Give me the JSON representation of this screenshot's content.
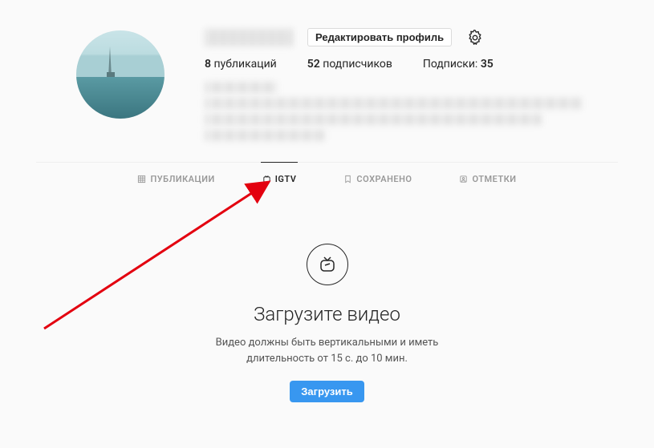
{
  "header": {
    "edit_profile_label": "Редактировать профиль"
  },
  "stats": {
    "posts_count": "8",
    "posts_label": "публикаций",
    "followers_count": "52",
    "followers_label": "подписчиков",
    "following_label": "Подписки:",
    "following_count": "35"
  },
  "tabs": {
    "posts": "ПУБЛИКАЦИИ",
    "igtv": "IGTV",
    "saved": "СОХРАНЕНО",
    "tagged": "ОТМЕТКИ"
  },
  "empty": {
    "title": "Загрузите видео",
    "line1": "Видео должны быть вертикальными и иметь",
    "line2": "длительность от 15 с. до 10 мин.",
    "upload_label": "Загрузить"
  }
}
